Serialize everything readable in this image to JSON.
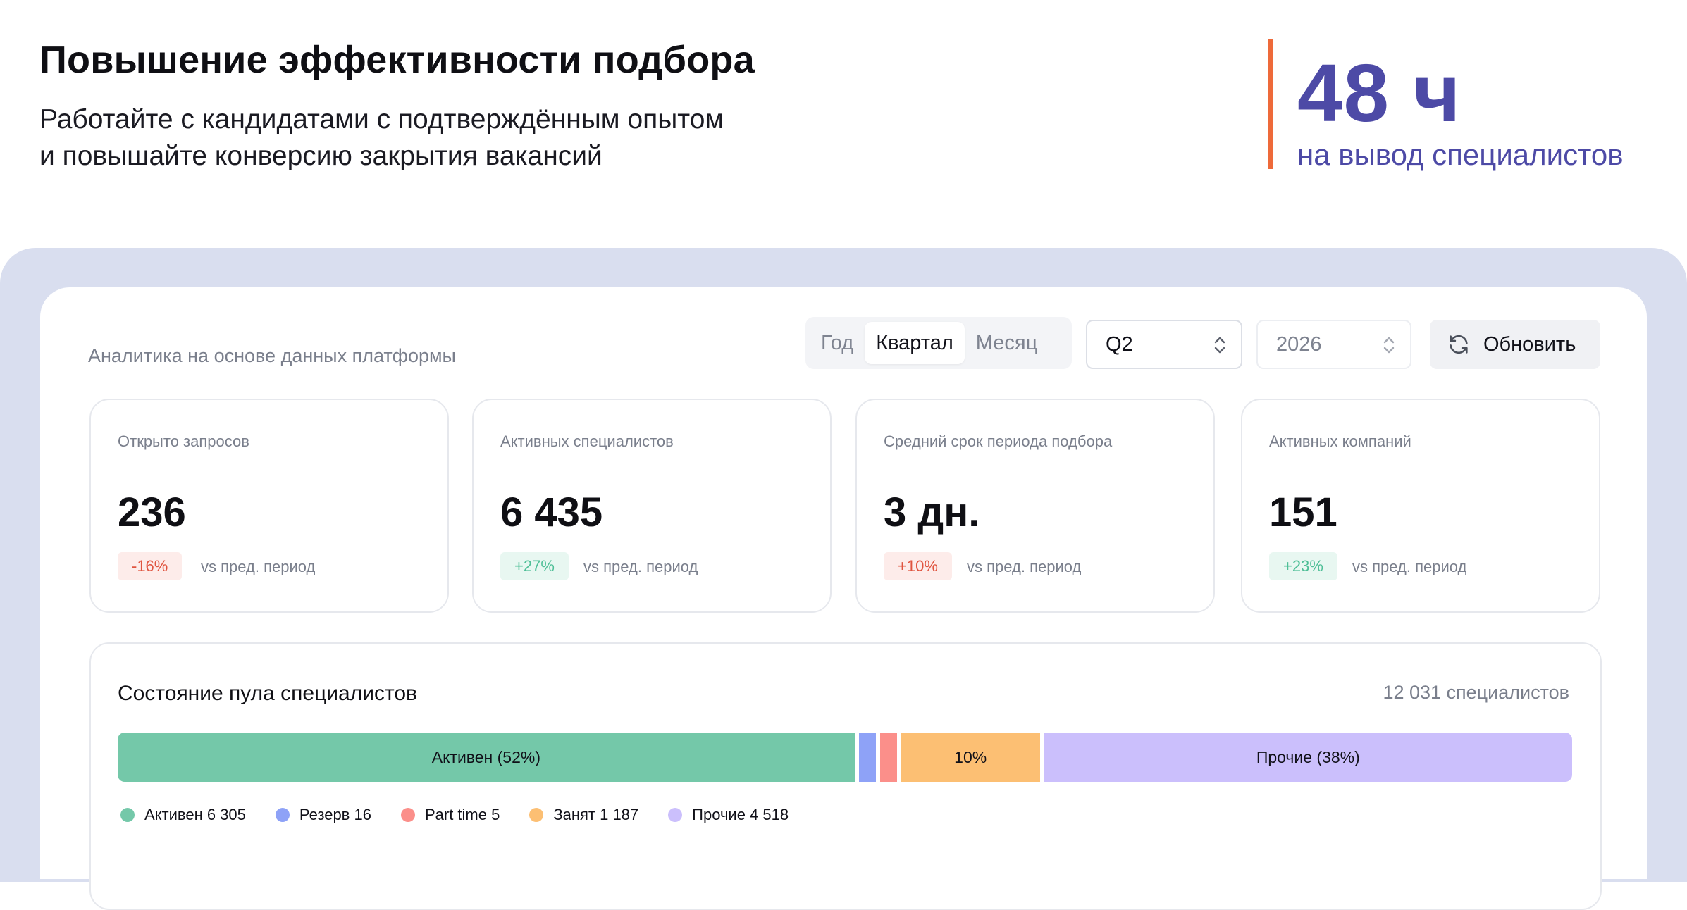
{
  "hero": {
    "title": "Повышение эффективности подбора",
    "subtitle_line1": "Работайте с кандидатами с подтверждённым опытом",
    "subtitle_line2": "и повышайте конверсию закрытия вакансий",
    "stat_value": "48 ч",
    "stat_caption": "на вывод специалистов",
    "accent_color": "#ee6a3a",
    "stat_color": "#4d4aa6"
  },
  "panel": {
    "caption": "Аналитика на основе данных платформы"
  },
  "filters": {
    "period_tabs": [
      {
        "label": "Год",
        "active": false
      },
      {
        "label": "Квартал",
        "active": true
      },
      {
        "label": "Месяц",
        "active": false
      }
    ],
    "quarter": {
      "value": "Q2",
      "icon": "chevron-updown-icon"
    },
    "year": {
      "value": "2026",
      "icon": "chevron-updown-icon"
    },
    "refresh": {
      "label": "Обновить",
      "icon": "refresh-icon"
    }
  },
  "cards": [
    {
      "label": "Открыто запросов",
      "value": "236",
      "delta": "-16%",
      "trend": "negative",
      "vs": "vs пред. период"
    },
    {
      "label": "Активных специалистов",
      "value": "6 435",
      "delta": "+27%",
      "trend": "positive",
      "vs": "vs пред. период"
    },
    {
      "label": "Средний срок периода подбора",
      "value": "3 дн.",
      "delta": "+10%",
      "trend": "negative",
      "vs": "vs пред. период"
    },
    {
      "label": "Активных компаний",
      "value": "151",
      "delta": "+23%",
      "trend": "positive",
      "vs": "vs пред. период"
    }
  ],
  "pool": {
    "title": "Состояние пула специалистов",
    "total": "12 031 специалистов",
    "segments": [
      {
        "name": "Активен",
        "count": 6305,
        "bar_label": "Активен (52%)",
        "legend": "Активен 6 305",
        "color": "#74c8a9"
      },
      {
        "name": "Резерв",
        "count": 16,
        "bar_label": "",
        "legend": "Резерв 16",
        "color": "#8ea2f7"
      },
      {
        "name": "Part time",
        "count": 5,
        "bar_label": "",
        "legend": "Part time 5",
        "color": "#fb8f8a"
      },
      {
        "name": "Занят",
        "count": 1187,
        "bar_label": "10%",
        "legend": "Занят 1 187",
        "color": "#fcbf73"
      },
      {
        "name": "Прочие",
        "count": 4518,
        "bar_label": "Прочие (38%)",
        "legend": "Прочие 4 518",
        "color": "#cbbffc"
      }
    ]
  }
}
